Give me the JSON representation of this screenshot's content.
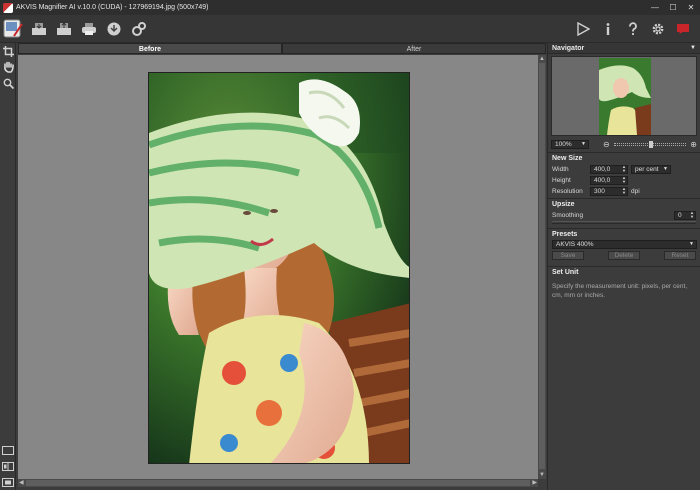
{
  "window": {
    "title": "AKVIS Magnifier AI v.10.0 (CUDA) - 127969194.jpg (500x749)",
    "min": "—",
    "max": "☐",
    "close": "✕"
  },
  "toolbar": {
    "left_icons": [
      "open-icon",
      "save-icon",
      "print-icon",
      "share-icon",
      "plugins-icon"
    ],
    "right_icons": [
      "run-icon",
      "info-icon",
      "help-icon",
      "settings-icon",
      "tips-icon"
    ]
  },
  "tools": {
    "top": [
      "crop-icon",
      "hand-icon",
      "zoom-icon"
    ],
    "bottom": [
      "view-single-icon",
      "view-split-icon",
      "view-fit-icon"
    ]
  },
  "tabs": {
    "before": "Before",
    "after": "After"
  },
  "navigator": {
    "title": "Navigator",
    "zoom": "100%"
  },
  "new_size": {
    "title": "New Size",
    "width_label": "Width",
    "width_value": "400,0",
    "height_label": "Height",
    "height_value": "400,0",
    "unit": "per cent",
    "resolution_label": "Resolution",
    "resolution_value": "300",
    "resolution_unit": "dpi"
  },
  "upsize": {
    "title": "Upsize",
    "smoothing_label": "Smoothing",
    "smoothing_value": "0"
  },
  "presets": {
    "title": "Presets",
    "selected": "AKVIS 400%",
    "save": "Save",
    "delete": "Delete",
    "reset": "Reset"
  },
  "help": {
    "title": "Set Unit",
    "text": "Specify the measurement unit: pixels, per cent, cm, mm or inches."
  },
  "colors": {
    "accent_red": "#c8252b",
    "bg": "#3c3c3c"
  }
}
